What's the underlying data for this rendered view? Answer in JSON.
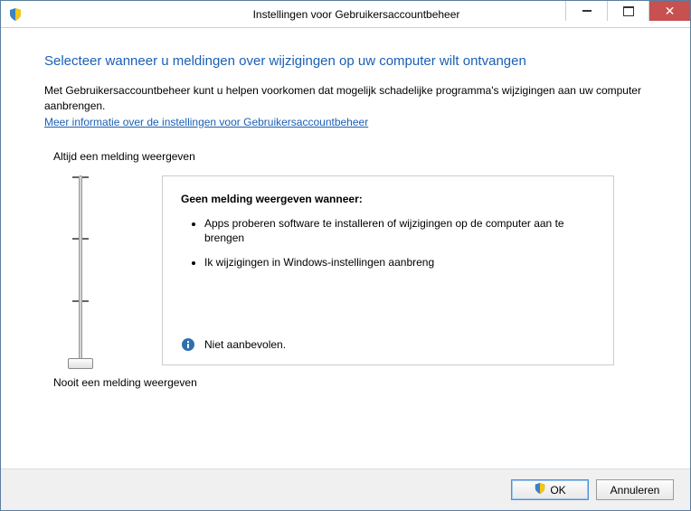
{
  "window": {
    "title": "Instellingen voor Gebruikersaccountbeheer"
  },
  "heading": "Selecteer wanneer u meldingen over wijzigingen op uw computer wilt ontvangen",
  "description": "Met Gebruikersaccountbeheer kunt u helpen voorkomen dat mogelijk schadelijke programma's wijzigingen aan uw computer aanbrengen.",
  "link": "Meer informatie over de instellingen voor Gebruikersaccountbeheer",
  "slider": {
    "label_top": "Altijd een melding weergeven",
    "label_bottom": "Nooit een melding weergeven",
    "levels": 4,
    "current_index": 3
  },
  "info": {
    "title": "Geen melding weergeven wanneer:",
    "items": [
      "Apps proberen software te installeren of wijzigingen op de computer aan te brengen",
      "Ik wijzigingen in Windows-instellingen aanbreng"
    ],
    "footer": "Niet aanbevolen."
  },
  "buttons": {
    "ok": "OK",
    "cancel": "Annuleren"
  },
  "icons": {
    "shield": "shield-icon",
    "info": "info-icon"
  }
}
